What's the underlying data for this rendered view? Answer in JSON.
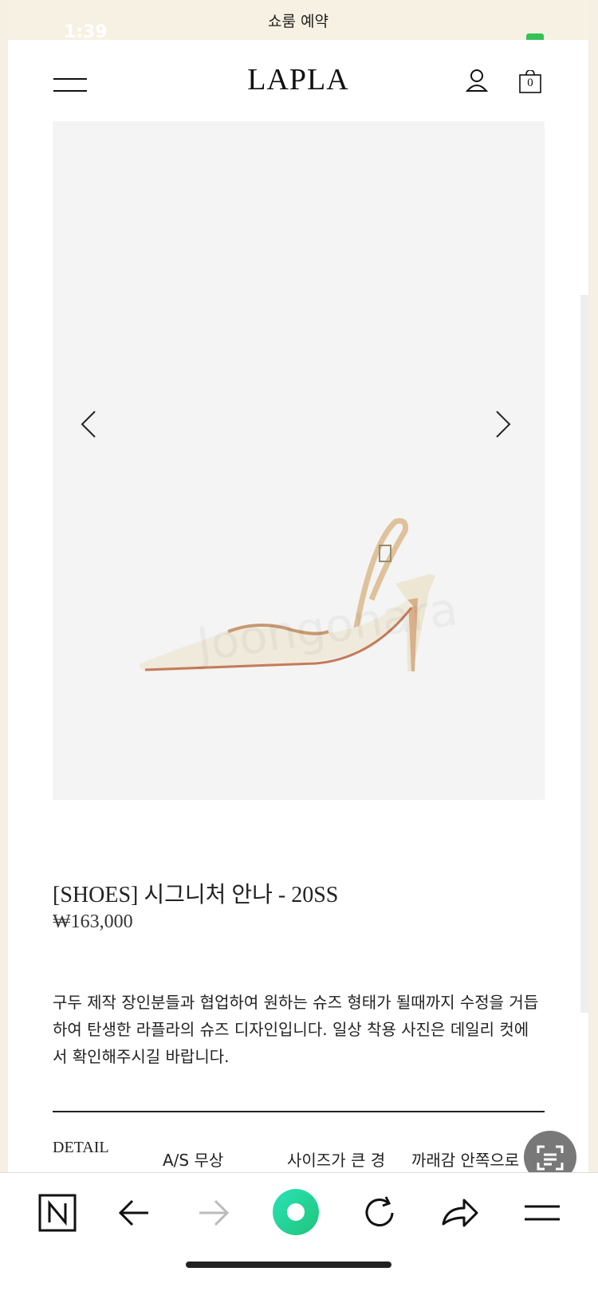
{
  "banner": {
    "text": "쇼룸 예약"
  },
  "status_bar": {
    "time": "1:39"
  },
  "header": {
    "logo": "LAPLA",
    "cart_count": "0"
  },
  "product": {
    "title": "[SHOES] 시그니처 안나 - 20SS",
    "price": "₩163,000",
    "description": "구두 제작 장인분들과 협업하여 원하는 슈즈 형태가 될때까지 수정을 거듭하여 탄생한 라플라의 슈즈 디자인입니다. 일상 착용 사진은 데일리 컷에서 확인해주시길 바랍니다.",
    "detail_label": "DETAIL",
    "detail_columns": [
      "A/S 무상",
      "사이즈가 큰 경우",
      "까래감 안쪽으로 깔창 보완해 발 사이즈"
    ]
  },
  "colors": {
    "accent_green": "#2bd6a0",
    "banner_bg": "#f7f1e3",
    "image_bg": "#f4f4f4"
  },
  "toolbar": {
    "icons": [
      "naver-n-icon",
      "back-arrow-icon",
      "forward-arrow-icon",
      "green-dot-icon",
      "refresh-icon",
      "share-icon",
      "menu-icon"
    ]
  }
}
